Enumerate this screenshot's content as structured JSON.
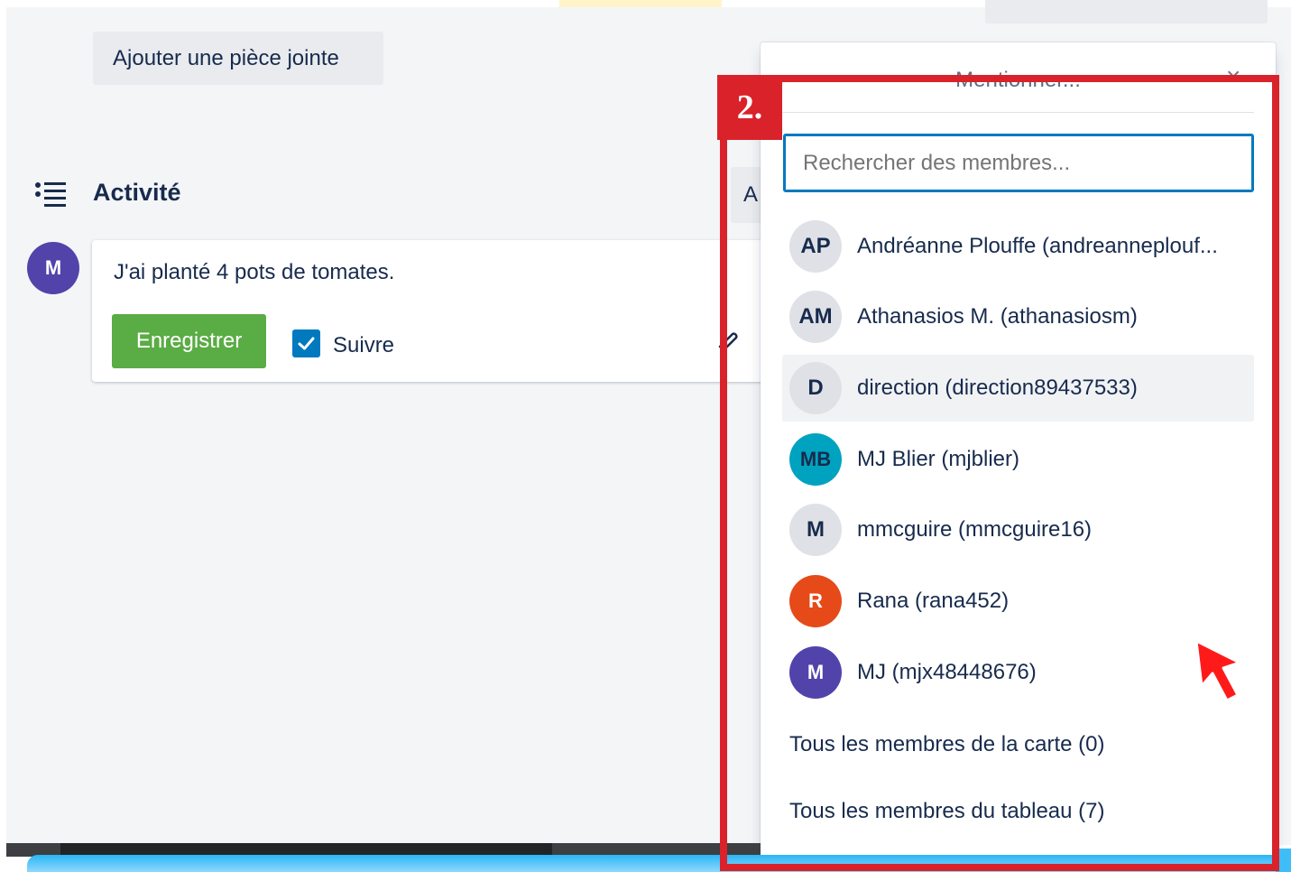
{
  "toolbar": {
    "attach_label": "Ajouter une pièce jointe"
  },
  "activity": {
    "title": "Activité",
    "user_initial": "M",
    "comment_text": "J'ai planté 4 pots de tomates.",
    "save_label": "Enregistrer",
    "follow_label": "Suivre",
    "follow_checked": true,
    "side_button_label": "A"
  },
  "mention_popup": {
    "title": "Mentionner...",
    "close_label": "×",
    "search_placeholder": "Rechercher des membres...",
    "members": [
      {
        "initials": "AP",
        "label": "Andréanne Plouffe (andreanneplouf...",
        "avatar_color": "#dfe1e6"
      },
      {
        "initials": "AM",
        "label": "Athanasios M. (athanasiosm)",
        "avatar_color": "#dfe1e6"
      },
      {
        "initials": "D",
        "label": "direction (direction89437533)",
        "avatar_color": "#dfe1e6",
        "highlighted": true
      },
      {
        "initials": "MB",
        "label": "MJ Blier (mjblier)",
        "avatar_color": "#00a3bf"
      },
      {
        "initials": "M",
        "label": "mmcguire (mmcguire16)",
        "avatar_color": "#dfe1e6"
      },
      {
        "initials": "R",
        "label": "Rana (rana452)",
        "avatar_color": "#e64a19"
      },
      {
        "initials": "M",
        "label": "MJ (mjx48448676)",
        "avatar_color": "#5243aa"
      }
    ],
    "card_members_label": "Tous les membres de la carte (0)",
    "board_members_label": "Tous les membres du tableau (7)"
  },
  "annotation": {
    "step_label": "2.",
    "color": "#d9222a"
  },
  "colors": {
    "save_green": "#5aac44",
    "checkbox_blue": "#0079bf",
    "focus_blue": "#0079bf"
  }
}
